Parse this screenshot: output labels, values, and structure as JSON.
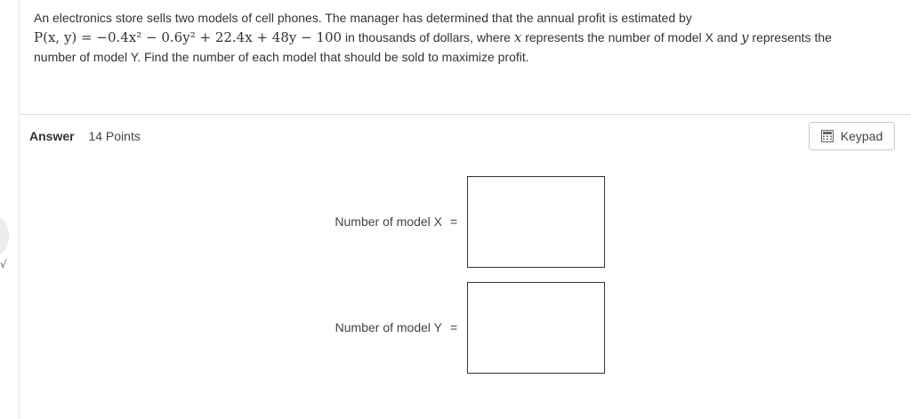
{
  "question": {
    "line1": "An electronics store sells two models of cell phones. The manager has determined that the annual profit is estimated by",
    "formula": "P(x, y) = −0.4x² − 0.6y² + 22.4x + 48y − 100",
    "line2_rest": " in thousands of dollars, where ",
    "var_x": "x",
    "line2_mid": " represents the number of model X and ",
    "var_y": "y",
    "line2_end": " represents the",
    "line3": "number of model Y. Find the number of each model that should be sold to maximize profit."
  },
  "answer": {
    "label": "Answer",
    "points": "14 Points"
  },
  "keypad": {
    "label": "Keypad",
    "icon": "calculator-icon"
  },
  "fields": [
    {
      "label": "Number of model X",
      "eq": "=",
      "value": ""
    },
    {
      "label": "Number of model Y",
      "eq": "=",
      "value": ""
    }
  ],
  "side": {
    "mark": "√"
  }
}
